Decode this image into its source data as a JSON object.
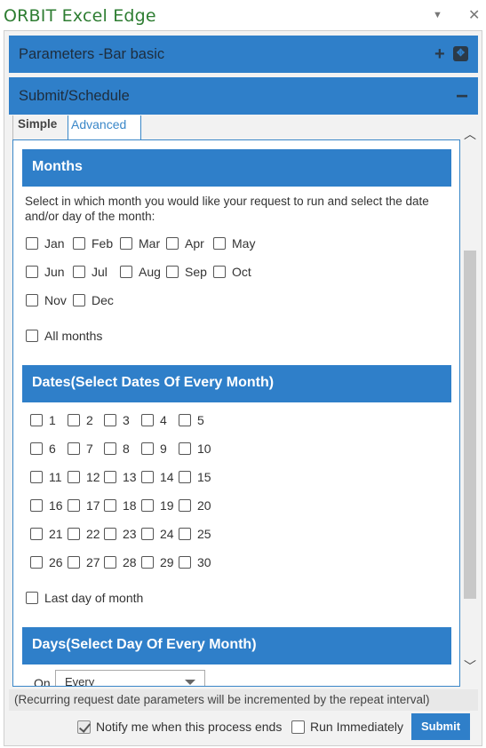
{
  "window": {
    "title": "ORBIT Excel Edge",
    "menu_glyph": "▼",
    "close_glyph": "✕"
  },
  "accordion": {
    "parameters_label": "Parameters -Bar basic",
    "submit_label": "Submit/Schedule"
  },
  "tabs": [
    {
      "label": "Simple",
      "active": false
    },
    {
      "label": "Advanced",
      "active": true
    }
  ],
  "months_section": {
    "header": "Months",
    "description": "Select in which month you would like your request to run and select the date and/or day of the month:",
    "months": [
      "Jan",
      "Feb",
      "Mar",
      "Apr",
      "May",
      "Jun",
      "Jul",
      "Aug",
      "Sep",
      "Oct",
      "Nov",
      "Dec"
    ],
    "all_label": "All months"
  },
  "dates_section": {
    "header": "Dates(Select Dates Of Every Month)",
    "dates": [
      "1",
      "2",
      "3",
      "4",
      "5",
      "6",
      "7",
      "8",
      "9",
      "10",
      "11",
      "12",
      "13",
      "14",
      "15",
      "16",
      "17",
      "18",
      "19",
      "20",
      "21",
      "22",
      "23",
      "24",
      "25",
      "26",
      "27",
      "28",
      "29",
      "30"
    ],
    "last_day_label": "Last day of month"
  },
  "days_section": {
    "header": "Days(Select Day Of Every Month)",
    "on_label": "On",
    "selected_option": "Every"
  },
  "note": "(Recurring request date parameters will be incremented by the repeat interval)",
  "footer": {
    "notify_label": "Notify me when this process ends",
    "notify_checked": true,
    "run_immediately_label": "Run Immediately",
    "run_immediately_checked": false,
    "submit_label": "Submit"
  },
  "colors": {
    "accent": "#2f7fc9",
    "title_green": "#2e7d32",
    "tab_active": "#3a87c8"
  },
  "icons": {
    "plus": "plus-icon",
    "expand": "expand-icon",
    "collapse": "minus-icon",
    "scroll_up": "chevron-up-icon",
    "scroll_down": "chevron-down-icon",
    "dropdown": "caret-down-icon"
  }
}
